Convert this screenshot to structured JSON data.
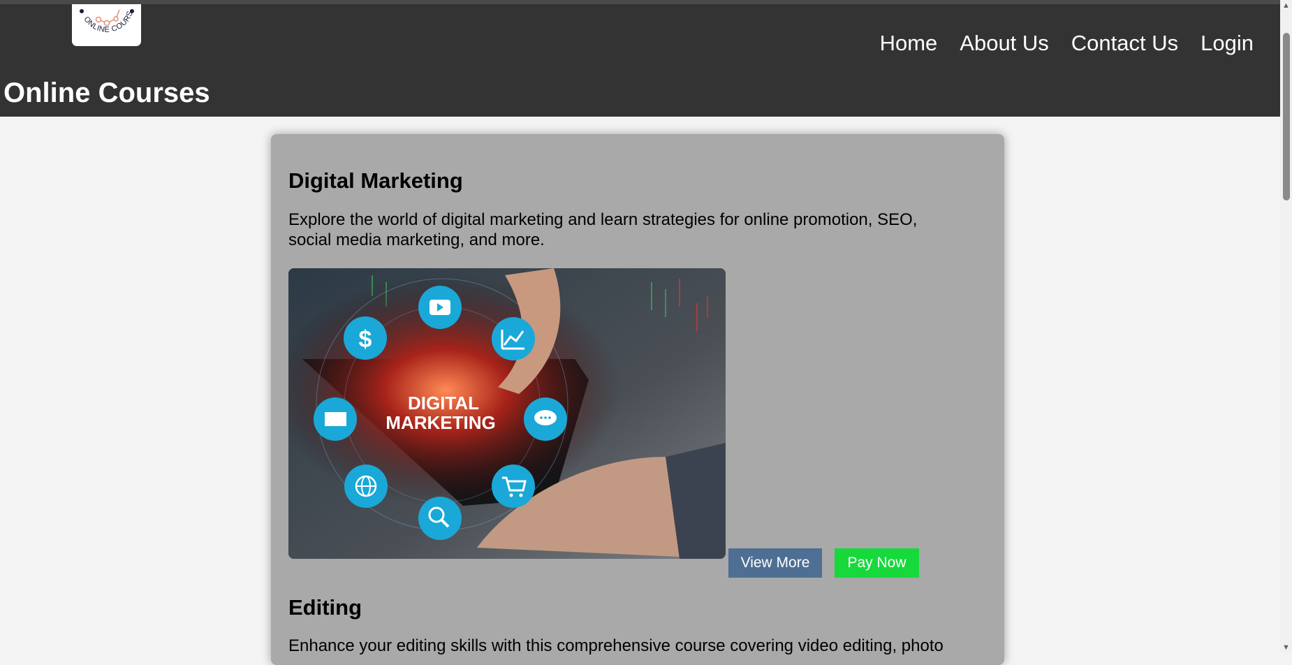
{
  "header": {
    "logo_text": "ONLINE COURSE",
    "site_title": "Online Courses",
    "nav": [
      {
        "label": "Home"
      },
      {
        "label": "About Us"
      },
      {
        "label": "Contact Us"
      },
      {
        "label": "Login"
      }
    ],
    "colors": {
      "header_bg": "#333333",
      "page_bg": "#f4f4f4"
    }
  },
  "courses": [
    {
      "title": "Digital Marketing",
      "description": "Explore the world of digital marketing and learn strategies for online promotion, SEO, social media marketing, and more.",
      "image_text_line1": "DIGITAL",
      "image_text_line2": "MARKETING",
      "view_more_label": "View More",
      "pay_now_label": "Pay Now"
    },
    {
      "title": "Editing",
      "description": "Enhance your editing skills with this comprehensive course covering video editing, photo"
    }
  ],
  "colors": {
    "card_bg": "#a9a9a9",
    "view_more_bg": "#4e6f93",
    "pay_now_bg": "#17d93c"
  },
  "icons": [
    "dollar-icon",
    "play-icon",
    "chart-icon",
    "mail-icon",
    "chat-icon",
    "globe-icon",
    "search-icon",
    "cart-icon"
  ]
}
